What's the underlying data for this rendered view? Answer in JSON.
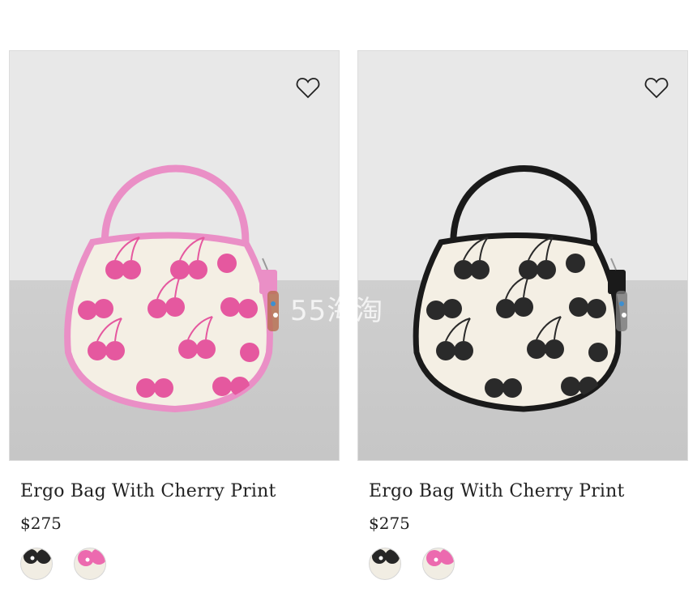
{
  "products": [
    {
      "title": "Ergo Bag With Cherry Print",
      "price": "$275",
      "bag_color": "pink",
      "accent": "#ef8fc3",
      "swatches": [
        {
          "color": "black-cherry"
        },
        {
          "color": "pink-cherry"
        }
      ]
    },
    {
      "title": "Ergo Bag With Cherry Print",
      "price": "$275",
      "bag_color": "black",
      "accent": "#1c1c1c",
      "swatches": [
        {
          "color": "black-cherry"
        },
        {
          "color": "pink-cherry"
        }
      ]
    }
  ],
  "icons": {
    "wishlist": "heart-outline-icon"
  },
  "watermark": "55海淘"
}
